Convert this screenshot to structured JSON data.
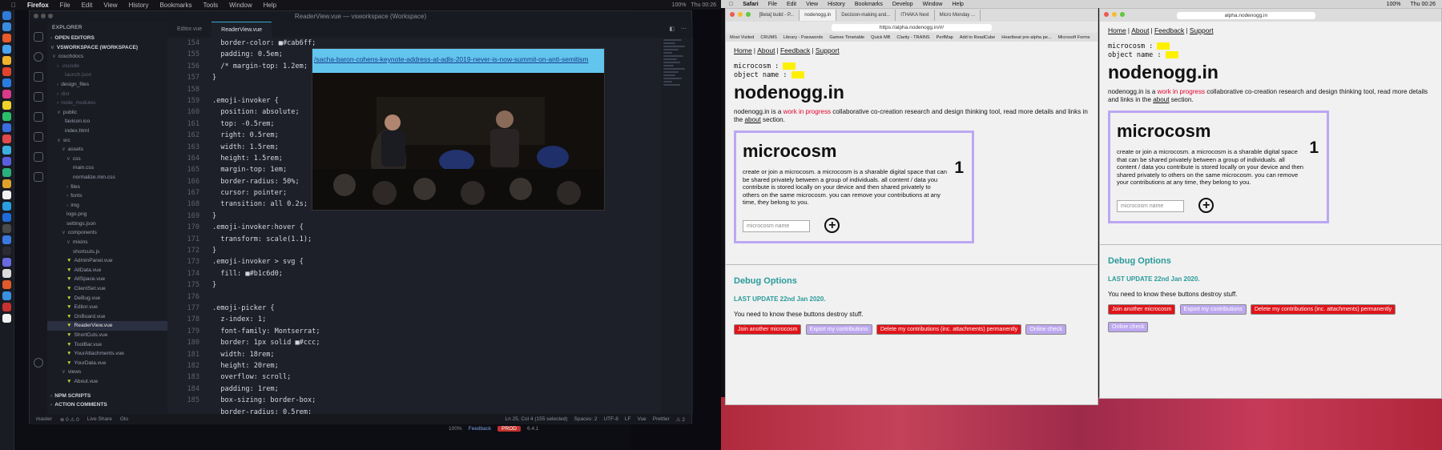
{
  "menubar": {
    "apple": "",
    "app": "Firefox",
    "items": [
      "File",
      "Edit",
      "View",
      "History",
      "Bookmarks",
      "Tools",
      "Window",
      "Help"
    ],
    "battery": "100%",
    "clock": "Thu 00:26"
  },
  "safari_menubar": {
    "app": "Safari",
    "items": [
      "File",
      "Edit",
      "View",
      "History",
      "Bookmarks",
      "Develop",
      "Window",
      "Help"
    ],
    "battery": "100%",
    "clock": "Thu 00:26"
  },
  "vscode": {
    "title": "ReaderView.vue — vsworkspace (Workspace)",
    "sidebar": {
      "explorer": "EXPLORER",
      "open_editors": "OPEN EDITORS",
      "workspace": "VSWORKSPACE (WORKSPACE)",
      "rows": [
        {
          "label": "couchdocs",
          "cls": "",
          "indent": 6,
          "chev": "∨",
          "vue": false
        },
        {
          "label": ".vscode",
          "cls": "dim",
          "indent": 12,
          "chev": "›",
          "vue": false
        },
        {
          "label": "launch.json",
          "cls": "dim",
          "indent": 22,
          "chev": "",
          "vue": false
        },
        {
          "label": "design_files",
          "cls": "",
          "indent": 12,
          "chev": "›",
          "vue": false
        },
        {
          "label": "dist",
          "cls": "dim",
          "indent": 12,
          "chev": "›",
          "vue": false
        },
        {
          "label": "node_modules",
          "cls": "dim",
          "indent": 12,
          "chev": "›",
          "vue": false
        },
        {
          "label": "public",
          "cls": "",
          "indent": 12,
          "chev": "∨",
          "vue": false
        },
        {
          "label": "favicon.ico",
          "cls": "",
          "indent": 22,
          "chev": "",
          "vue": false
        },
        {
          "label": "index.html",
          "cls": "",
          "indent": 22,
          "chev": "",
          "vue": false
        },
        {
          "label": "src",
          "cls": "",
          "indent": 12,
          "chev": "∨",
          "vue": false
        },
        {
          "label": "assets",
          "cls": "",
          "indent": 18,
          "chev": "∨",
          "vue": false
        },
        {
          "label": "css",
          "cls": "",
          "indent": 24,
          "chev": "∨",
          "vue": false
        },
        {
          "label": "main.css",
          "cls": "",
          "indent": 32,
          "chev": "",
          "vue": false
        },
        {
          "label": "normalize.min.css",
          "cls": "",
          "indent": 32,
          "chev": "",
          "vue": false
        },
        {
          "label": "files",
          "cls": "",
          "indent": 24,
          "chev": "›",
          "vue": false
        },
        {
          "label": "fonts",
          "cls": "",
          "indent": 24,
          "chev": "›",
          "vue": false
        },
        {
          "label": "img",
          "cls": "",
          "indent": 24,
          "chev": "›",
          "vue": false
        },
        {
          "label": "logo.png",
          "cls": "",
          "indent": 24,
          "chev": "",
          "vue": false
        },
        {
          "label": "settings.json",
          "cls": "",
          "indent": 24,
          "chev": "",
          "vue": false
        },
        {
          "label": "components",
          "cls": "",
          "indent": 18,
          "chev": "∨",
          "vue": false
        },
        {
          "label": "mixins",
          "cls": "",
          "indent": 24,
          "chev": "∨",
          "vue": false
        },
        {
          "label": "shortcuts.js",
          "cls": "",
          "indent": 32,
          "chev": "",
          "vue": false
        },
        {
          "label": "AdminPanel.vue",
          "cls": "",
          "indent": 24,
          "chev": "",
          "vue": true
        },
        {
          "label": "AllData.vue",
          "cls": "",
          "indent": 24,
          "chev": "",
          "vue": true
        },
        {
          "label": "AllSpace.vue",
          "cls": "",
          "indent": 24,
          "chev": "",
          "vue": true
        },
        {
          "label": "ClientSet.vue",
          "cls": "",
          "indent": 24,
          "chev": "",
          "vue": true
        },
        {
          "label": "DeBug.vue",
          "cls": "",
          "indent": 24,
          "chev": "",
          "vue": true
        },
        {
          "label": "Editor.vue",
          "cls": "",
          "indent": 24,
          "chev": "",
          "vue": true
        },
        {
          "label": "OnBoard.vue",
          "cls": "",
          "indent": 24,
          "chev": "",
          "vue": true
        },
        {
          "label": "ReaderView.vue",
          "cls": "sel",
          "indent": 24,
          "chev": "",
          "vue": true
        },
        {
          "label": "ShortCuts.vue",
          "cls": "",
          "indent": 24,
          "chev": "",
          "vue": true
        },
        {
          "label": "ToolBar.vue",
          "cls": "",
          "indent": 24,
          "chev": "",
          "vue": true
        },
        {
          "label": "YourAttachments.vue",
          "cls": "",
          "indent": 24,
          "chev": "",
          "vue": true
        },
        {
          "label": "YourData.vue",
          "cls": "",
          "indent": 24,
          "chev": "",
          "vue": true
        },
        {
          "label": "views",
          "cls": "",
          "indent": 18,
          "chev": "∨",
          "vue": false
        },
        {
          "label": "About.vue",
          "cls": "",
          "indent": 24,
          "chev": "",
          "vue": true
        }
      ],
      "npm": "NPM SCRIPTS",
      "actions": "ACTION COMMENTS"
    },
    "tabs": [
      "Editor.vue",
      "ReaderView.vue"
    ],
    "lines": [
      "154",
      "155",
      "156",
      "157",
      "158",
      "159",
      "160",
      "161",
      "162",
      "163",
      "164",
      "165",
      "166",
      "167",
      "168",
      "169",
      "170",
      "171",
      "172",
      "173",
      "174",
      "175",
      "176",
      "177",
      "178",
      "179",
      "180",
      "181",
      "182",
      "183",
      "184",
      "185"
    ],
    "code": [
      "  border-color: ■#cab6ff;",
      "  padding: 0.5em;",
      "  /* margin-top: 1.2em;",
      "}",
      "",
      ".emoji-invoker {",
      "  position: absolute;",
      "  top: -0.5rem;",
      "  right: 0.5rem;",
      "  width: 1.5rem;",
      "  height: 1.5rem;",
      "  margin-top: 1em;",
      "  border-radius: 50%;",
      "  cursor: pointer;",
      "  transition: all 0.2s;",
      "}",
      ".emoji-invoker:hover {",
      "  transform: scale(1.1);",
      "}",
      ".emoji-invoker > svg {",
      "  fill: ■#b1c6d0;",
      "}",
      "",
      ".emoji-picker {",
      "  z-index: 1;",
      "  font-family: Montserrat;",
      "  border: 1px solid ■#ccc;",
      "  width: 18rem;",
      "  height: 20rem;",
      "  overflow: scroll;",
      "  padding: 1rem;",
      "  box-sizing: border-box;",
      "  border-radius: 0.5rem;"
    ],
    "status": {
      "branch": "master",
      "errors": "⊗ 0  ⚠ 0",
      "liveshare": "Live Share",
      "glo": "Glo",
      "position": "Ln 25, Col 4 (155 selected)",
      "spaces": "Spaces: 2",
      "encoding": "UTF-8",
      "eol": "LF",
      "lang": "Vue",
      "formatter": "Prettier",
      "bell": "⚠ 2",
      "zoom": "100%",
      "feedback": "Feedback",
      "prod": "PROD",
      "version": "6.4.1"
    }
  },
  "video": {
    "link": "/sacha-baron-cohens-keynote-address-at-adls-2019-never-is-now-summit-on-anti-semitism"
  },
  "browser1": {
    "tabs": [
      "[Beta] build - P...",
      "nodenogg.in",
      "Decision-making and...",
      "ITHAKA Next",
      "Micro Monday ..."
    ],
    "url": "https://alpha.nodenogg.in/#/",
    "favs": [
      "Most Visited",
      "CRUMS",
      "Library - Passwords",
      "Games Timetable",
      "Quick MB",
      "Clarity - TRAINS",
      "PerfMap",
      "Add to ReadCube",
      "Heartbeat pre-alpha pe...",
      "Microsoft Forms"
    ]
  },
  "browser2": {
    "url": "alpha.nodenogg.in"
  },
  "site": {
    "nav": [
      "Home",
      "About",
      "Feedback",
      "Support"
    ],
    "mc_label": "microcosm :",
    "obj_label": "object name :",
    "title": "nodenogg.in",
    "intro_pre": "nodenogg.in is a ",
    "wip": "work in progress",
    "intro_mid": " collaborative co-creation research and design thinking tool, read more details and links in the ",
    "about": "about",
    "intro_post": " section.",
    "mc_title": "microcosm",
    "mc_count": "1",
    "mc_desc": "create or join a microcosm. a microcosm is a sharable digital space that can be shared privately between a group of individuals. all content / data you contribute is stored locally on your device and then shared privately to others on the same microcosm. you can remove your contributions at any time, they belong to you.",
    "mc_placeholder": "microcosm name",
    "plus": "+",
    "debug": "Debug Options",
    "last_update": "LAST UPDATE 22nd Jan 2020.",
    "warning": "You need to know these buttons destroy stuff.",
    "buttons": {
      "join": "Join another microcosm",
      "export": "Export my contributions",
      "delete": "Delete my contributions (inc. attachments) permanently",
      "online": "Online check"
    }
  }
}
